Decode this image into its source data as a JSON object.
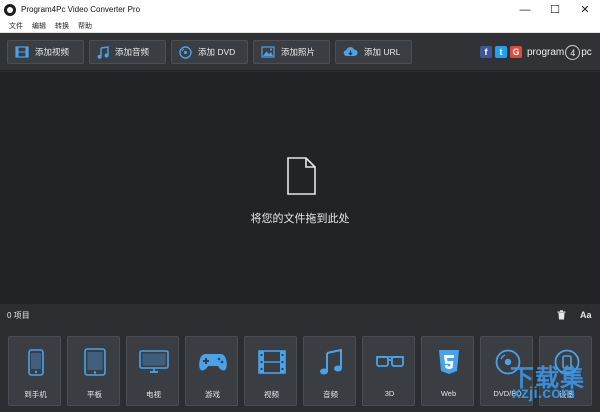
{
  "window": {
    "title": "Program4Pc Video Converter Pro"
  },
  "menu": [
    "文件",
    "编辑",
    "转换",
    "帮助"
  ],
  "toolbar": {
    "add_video": "添加视频",
    "add_audio": "添加音频",
    "add_dvd": "添加 DVD",
    "add_photo": "添加照片",
    "add_url": "添加 URL",
    "social": {
      "facebook": "f",
      "twitter": "t",
      "google": "G"
    },
    "brand": {
      "pre": "program",
      "num": "4",
      "post": "pc"
    }
  },
  "dropzone": {
    "message": "将您的文件拖到此处"
  },
  "status": {
    "count": "0 项目",
    "font_button": "Aa"
  },
  "profiles": [
    "到手机",
    "平板",
    "电视",
    "游戏",
    "视频",
    "音频",
    "3D",
    "Web",
    "DVD/BD",
    "设备"
  ],
  "watermark": {
    "cn": "下载集",
    "url": "xzji.com"
  },
  "colors": {
    "accent": "#2f8ad8",
    "facebook": "#3b5998",
    "twitter": "#1da1f2",
    "google": "#dd4b39"
  }
}
